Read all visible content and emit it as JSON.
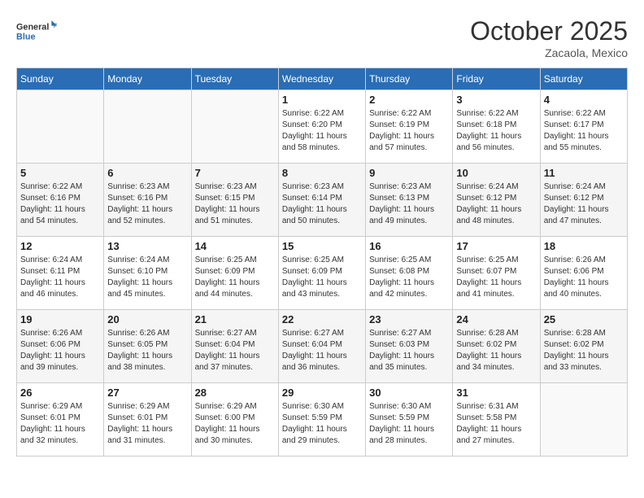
{
  "header": {
    "logo_line1": "General",
    "logo_line2": "Blue",
    "month": "October 2025",
    "location": "Zacaola, Mexico"
  },
  "weekdays": [
    "Sunday",
    "Monday",
    "Tuesday",
    "Wednesday",
    "Thursday",
    "Friday",
    "Saturday"
  ],
  "weeks": [
    [
      {
        "day": "",
        "info": ""
      },
      {
        "day": "",
        "info": ""
      },
      {
        "day": "",
        "info": ""
      },
      {
        "day": "1",
        "info": "Sunrise: 6:22 AM\nSunset: 6:20 PM\nDaylight: 11 hours\nand 58 minutes."
      },
      {
        "day": "2",
        "info": "Sunrise: 6:22 AM\nSunset: 6:19 PM\nDaylight: 11 hours\nand 57 minutes."
      },
      {
        "day": "3",
        "info": "Sunrise: 6:22 AM\nSunset: 6:18 PM\nDaylight: 11 hours\nand 56 minutes."
      },
      {
        "day": "4",
        "info": "Sunrise: 6:22 AM\nSunset: 6:17 PM\nDaylight: 11 hours\nand 55 minutes."
      }
    ],
    [
      {
        "day": "5",
        "info": "Sunrise: 6:22 AM\nSunset: 6:16 PM\nDaylight: 11 hours\nand 54 minutes."
      },
      {
        "day": "6",
        "info": "Sunrise: 6:23 AM\nSunset: 6:16 PM\nDaylight: 11 hours\nand 52 minutes."
      },
      {
        "day": "7",
        "info": "Sunrise: 6:23 AM\nSunset: 6:15 PM\nDaylight: 11 hours\nand 51 minutes."
      },
      {
        "day": "8",
        "info": "Sunrise: 6:23 AM\nSunset: 6:14 PM\nDaylight: 11 hours\nand 50 minutes."
      },
      {
        "day": "9",
        "info": "Sunrise: 6:23 AM\nSunset: 6:13 PM\nDaylight: 11 hours\nand 49 minutes."
      },
      {
        "day": "10",
        "info": "Sunrise: 6:24 AM\nSunset: 6:12 PM\nDaylight: 11 hours\nand 48 minutes."
      },
      {
        "day": "11",
        "info": "Sunrise: 6:24 AM\nSunset: 6:12 PM\nDaylight: 11 hours\nand 47 minutes."
      }
    ],
    [
      {
        "day": "12",
        "info": "Sunrise: 6:24 AM\nSunset: 6:11 PM\nDaylight: 11 hours\nand 46 minutes."
      },
      {
        "day": "13",
        "info": "Sunrise: 6:24 AM\nSunset: 6:10 PM\nDaylight: 11 hours\nand 45 minutes."
      },
      {
        "day": "14",
        "info": "Sunrise: 6:25 AM\nSunset: 6:09 PM\nDaylight: 11 hours\nand 44 minutes."
      },
      {
        "day": "15",
        "info": "Sunrise: 6:25 AM\nSunset: 6:09 PM\nDaylight: 11 hours\nand 43 minutes."
      },
      {
        "day": "16",
        "info": "Sunrise: 6:25 AM\nSunset: 6:08 PM\nDaylight: 11 hours\nand 42 minutes."
      },
      {
        "day": "17",
        "info": "Sunrise: 6:25 AM\nSunset: 6:07 PM\nDaylight: 11 hours\nand 41 minutes."
      },
      {
        "day": "18",
        "info": "Sunrise: 6:26 AM\nSunset: 6:06 PM\nDaylight: 11 hours\nand 40 minutes."
      }
    ],
    [
      {
        "day": "19",
        "info": "Sunrise: 6:26 AM\nSunset: 6:06 PM\nDaylight: 11 hours\nand 39 minutes."
      },
      {
        "day": "20",
        "info": "Sunrise: 6:26 AM\nSunset: 6:05 PM\nDaylight: 11 hours\nand 38 minutes."
      },
      {
        "day": "21",
        "info": "Sunrise: 6:27 AM\nSunset: 6:04 PM\nDaylight: 11 hours\nand 37 minutes."
      },
      {
        "day": "22",
        "info": "Sunrise: 6:27 AM\nSunset: 6:04 PM\nDaylight: 11 hours\nand 36 minutes."
      },
      {
        "day": "23",
        "info": "Sunrise: 6:27 AM\nSunset: 6:03 PM\nDaylight: 11 hours\nand 35 minutes."
      },
      {
        "day": "24",
        "info": "Sunrise: 6:28 AM\nSunset: 6:02 PM\nDaylight: 11 hours\nand 34 minutes."
      },
      {
        "day": "25",
        "info": "Sunrise: 6:28 AM\nSunset: 6:02 PM\nDaylight: 11 hours\nand 33 minutes."
      }
    ],
    [
      {
        "day": "26",
        "info": "Sunrise: 6:29 AM\nSunset: 6:01 PM\nDaylight: 11 hours\nand 32 minutes."
      },
      {
        "day": "27",
        "info": "Sunrise: 6:29 AM\nSunset: 6:01 PM\nDaylight: 11 hours\nand 31 minutes."
      },
      {
        "day": "28",
        "info": "Sunrise: 6:29 AM\nSunset: 6:00 PM\nDaylight: 11 hours\nand 30 minutes."
      },
      {
        "day": "29",
        "info": "Sunrise: 6:30 AM\nSunset: 5:59 PM\nDaylight: 11 hours\nand 29 minutes."
      },
      {
        "day": "30",
        "info": "Sunrise: 6:30 AM\nSunset: 5:59 PM\nDaylight: 11 hours\nand 28 minutes."
      },
      {
        "day": "31",
        "info": "Sunrise: 6:31 AM\nSunset: 5:58 PM\nDaylight: 11 hours\nand 27 minutes."
      },
      {
        "day": "",
        "info": ""
      }
    ]
  ]
}
